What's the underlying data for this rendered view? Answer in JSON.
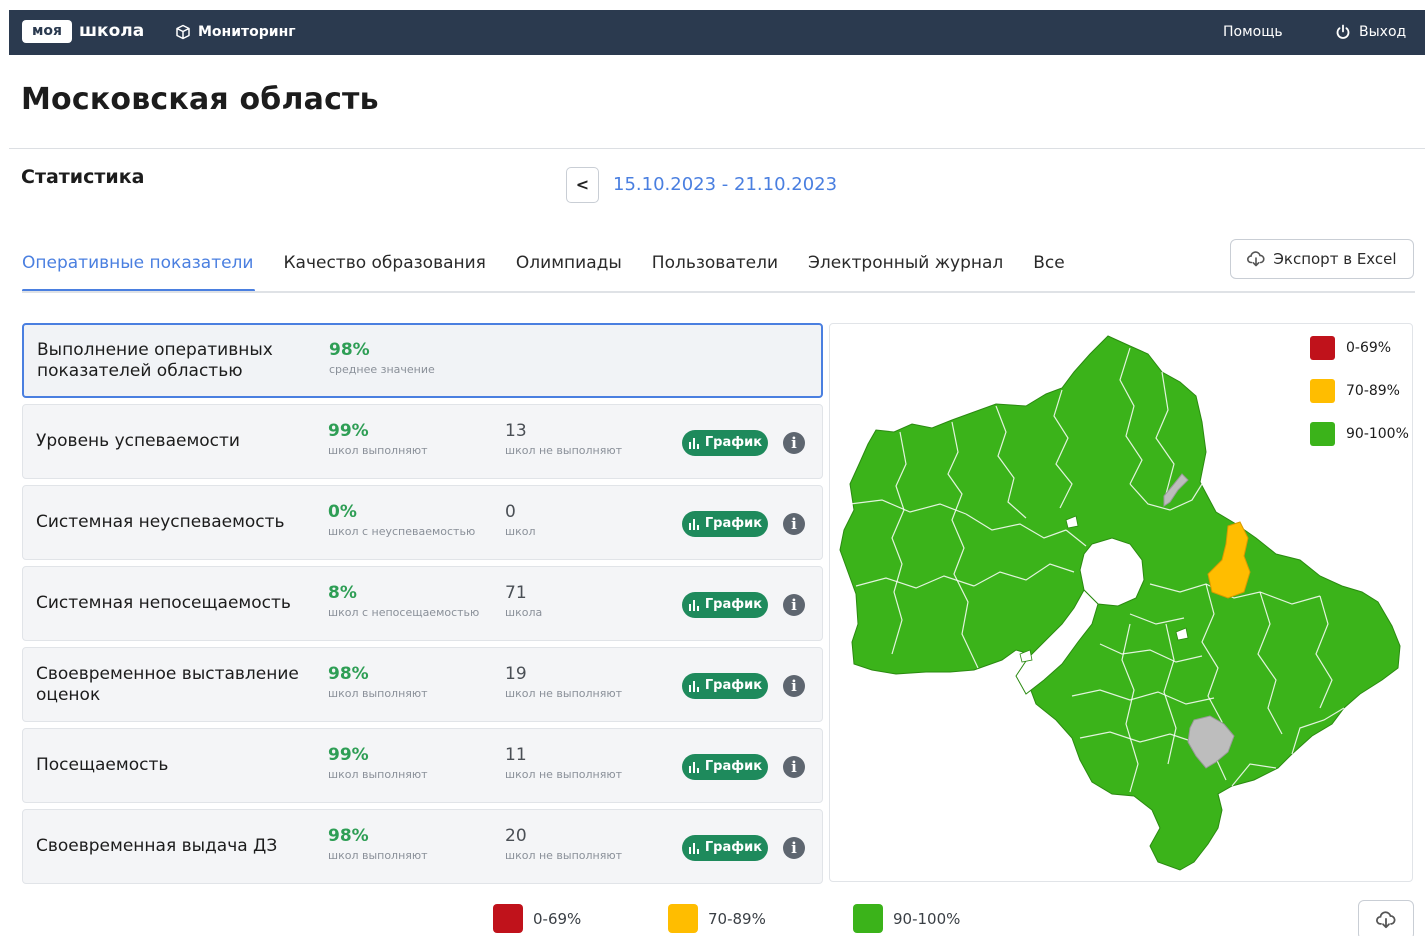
{
  "header": {
    "logo_badge": "моя",
    "logo_text": "школа",
    "nav_monitoring": "Мониторинг",
    "help": "Помощь",
    "logout": "Выход"
  },
  "page": {
    "title": "Московская область",
    "section_title": "Статистика",
    "date_prev": "<",
    "date_range": "15.10.2023 - 21.10.2023"
  },
  "tabs": [
    {
      "label": "Оперативные показатели",
      "active": true
    },
    {
      "label": "Качество образования",
      "active": false
    },
    {
      "label": "Олимпиады",
      "active": false
    },
    {
      "label": "Пользователи",
      "active": false
    },
    {
      "label": "Электронный журнал",
      "active": false
    },
    {
      "label": "Все",
      "active": false
    }
  ],
  "export_label": "Экспорт в Excel",
  "chart_button_label": "График",
  "info_symbol": "i",
  "cards": [
    {
      "title": "Выполнение оперативных показателей областью",
      "value1": "98%",
      "label1": "среднее значение",
      "value2": "",
      "label2": ""
    },
    {
      "title": "Уровень успеваемости",
      "value1": "99%",
      "label1": "школ выполняют",
      "value2": "13",
      "label2": "школ не выполняют"
    },
    {
      "title": "Системная неуспеваемость",
      "value1": "0%",
      "label1": "школ с неуспеваемостью",
      "value2": "0",
      "label2": "школ"
    },
    {
      "title": "Системная непосещаемость",
      "value1": "8%",
      "label1": "школ с непосещаемостью",
      "value2": "71",
      "label2": "школа"
    },
    {
      "title": "Своевременное выставление оценок",
      "value1": "98%",
      "label1": "школ выполняют",
      "value2": "19",
      "label2": "школ не выполняют"
    },
    {
      "title": "Посещаемость",
      "value1": "99%",
      "label1": "школ выполняют",
      "value2": "11",
      "label2": "школ не выполняют"
    },
    {
      "title": "Своевременная выдача ДЗ",
      "value1": "98%",
      "label1": "школ выполняют",
      "value2": "20",
      "label2": "школ не выполняют"
    }
  ],
  "legend": [
    {
      "label": "0-69%",
      "color": "#c0121b"
    },
    {
      "label": "70-89%",
      "color": "#ffbd00"
    },
    {
      "label": "90-100%",
      "color": "#3bb31a"
    }
  ],
  "colors": {
    "accent": "#4a7fe0",
    "topbar": "#2b3a4f",
    "map_green": "#3bb31a",
    "map_orange": "#ffbd00",
    "map_gray": "#bdbdbd",
    "chart_button": "#1e8a5c"
  }
}
